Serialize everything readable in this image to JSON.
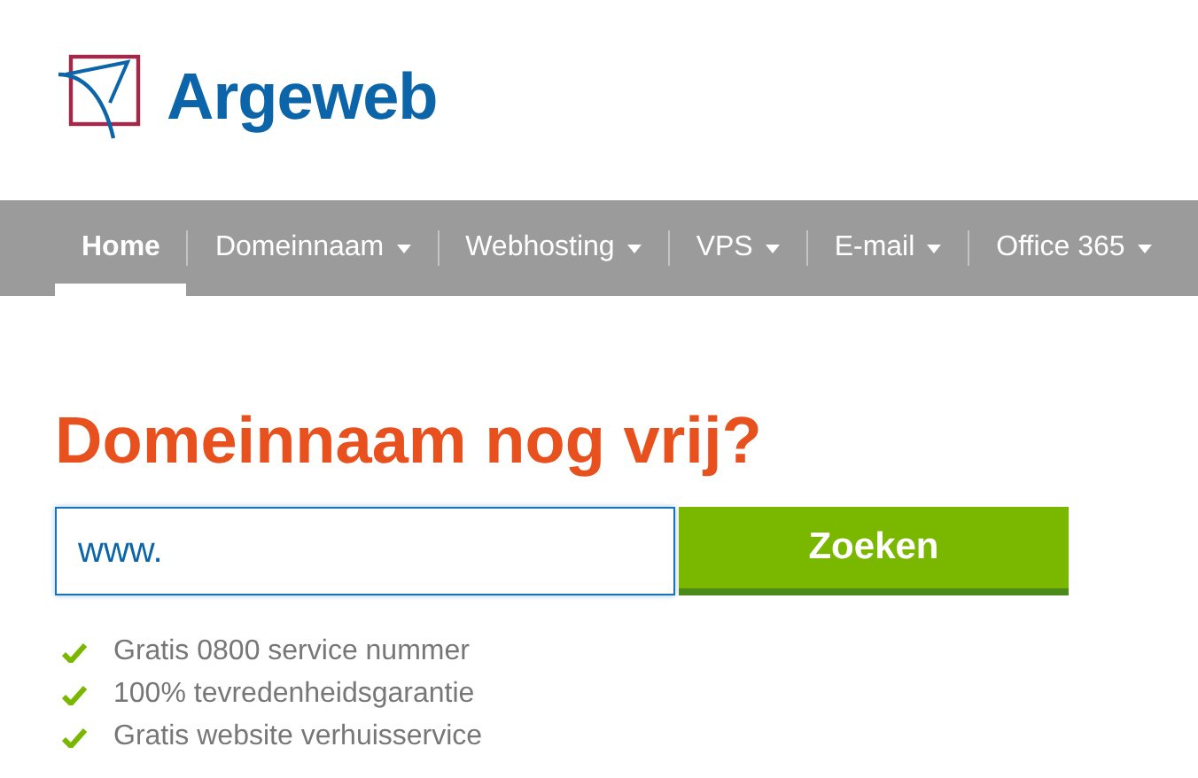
{
  "logo": {
    "text": "Argeweb"
  },
  "nav": [
    {
      "label": "Home",
      "selected": true,
      "dropdown": false
    },
    {
      "label": "Domeinnaam",
      "selected": false,
      "dropdown": true
    },
    {
      "label": "Webhosting",
      "selected": false,
      "dropdown": true
    },
    {
      "label": "VPS",
      "selected": false,
      "dropdown": true
    },
    {
      "label": "E-mail",
      "selected": false,
      "dropdown": true
    },
    {
      "label": "Office 365",
      "selected": false,
      "dropdown": true
    }
  ],
  "heading": "Domeinnaam nog vrij?",
  "search": {
    "value": "www.",
    "button": "Zoeken"
  },
  "features": [
    "Gratis 0800 service nummer",
    "100% tevredenheidsgarantie",
    "Gratis website verhuisservice"
  ]
}
